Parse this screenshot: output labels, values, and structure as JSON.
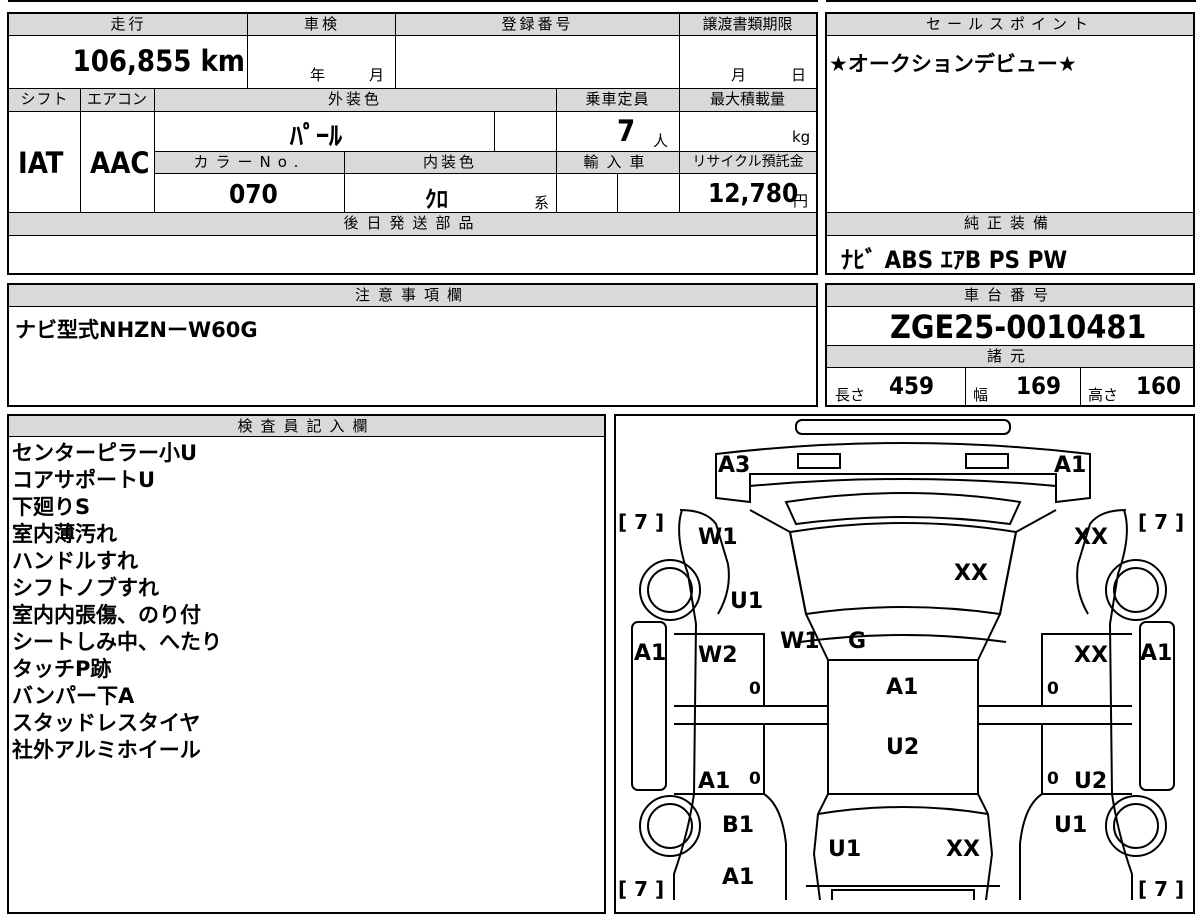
{
  "headers": {
    "mileage": "走行",
    "inspection": "車検",
    "registration_number": "登録番号",
    "transfer_deadline": "譲渡書類期限",
    "sales_point": "セールスポイント",
    "shift": "シフト",
    "aircon": "エアコン",
    "exterior_color": "外装色",
    "capacity": "乗車定員",
    "max_load": "最大積載量",
    "color_no": "カラーNo.",
    "interior_color": "内装色",
    "import": "輸入車",
    "recycle_fee": "リサイクル預託金",
    "later_parts": "後日発送部品",
    "equipment": "純正装備",
    "notes": "注意事項欄",
    "chassis_number": "車台番号",
    "specs": "諸元",
    "inspector": "検査員記入欄"
  },
  "values": {
    "mileage": "106,855 km",
    "inspection_year_unit": "年",
    "inspection_month_unit": "月",
    "transfer_month_unit": "月",
    "transfer_day_unit": "日",
    "sales_point": "★オークションデビュー★",
    "shift": "IAT",
    "aircon": "AAC",
    "exterior_color": "ﾊﾟｰﾙ",
    "capacity": "7",
    "capacity_unit": "人",
    "max_load_unit": "kg",
    "color_no": "070",
    "interior_color": "ｸﾛ",
    "interior_suffix": "系",
    "recycle_fee": "12,780",
    "recycle_unit": "円",
    "equipment": "ﾅﾋﾞ ABS ｴｱB PS PW",
    "notes": "ナビ型式NHZNーW60G",
    "chassis_number": "ZGE25-0010481",
    "length_label": "長さ",
    "length": "459",
    "width_label": "幅",
    "width": "169",
    "height_label": "高さ",
    "height": "160"
  },
  "inspector_notes": [
    "センターピラー小U",
    "コアサポートU",
    "下廻りS",
    "室内薄汚れ",
    "ハンドルすれ",
    "シフトノブすれ",
    "室内内張傷、のり付",
    "シートしみ中、へたり",
    "タッチP跡",
    "バンパー下A",
    "スタッドレスタイヤ",
    "社外アルミホイール"
  ],
  "diagram": {
    "tread_front_left": "[ 7 ]",
    "tread_front_right": "[ 7 ]",
    "tread_rear_left": "[ 7 ]",
    "tread_rear_right": "[ 7 ]",
    "marks": [
      {
        "id": "front-left-corner",
        "text": "A3"
      },
      {
        "id": "front-right-corner",
        "text": "A1"
      },
      {
        "id": "left-fender",
        "text": "W1"
      },
      {
        "id": "right-fender",
        "text": "XX"
      },
      {
        "id": "windshield",
        "text": "XX"
      },
      {
        "id": "left-pillar",
        "text": "U1"
      },
      {
        "id": "left-a-pillar",
        "text": "W1"
      },
      {
        "id": "roof-front",
        "text": "G"
      },
      {
        "id": "left-front-door",
        "text": "W2"
      },
      {
        "id": "right-front-door",
        "text": "XX"
      },
      {
        "id": "left-rocker",
        "text": "A1"
      },
      {
        "id": "right-rocker",
        "text": "A1"
      },
      {
        "id": "roof",
        "text": "A1"
      },
      {
        "id": "roof-rear",
        "text": "U2"
      },
      {
        "id": "left-rear-door",
        "text": "A1"
      },
      {
        "id": "right-rear-door",
        "text": "U2"
      },
      {
        "id": "left-quarter",
        "text": "B1"
      },
      {
        "id": "right-quarter",
        "text": "U1"
      },
      {
        "id": "rear-glass-left",
        "text": "U1"
      },
      {
        "id": "rear-glass-right",
        "text": "XX"
      },
      {
        "id": "rear-bumper",
        "text": "A1"
      },
      {
        "id": "zero-lf",
        "text": "0"
      },
      {
        "id": "zero-rf",
        "text": "0"
      },
      {
        "id": "zero-lr",
        "text": "0"
      },
      {
        "id": "zero-rr",
        "text": "0"
      }
    ]
  }
}
